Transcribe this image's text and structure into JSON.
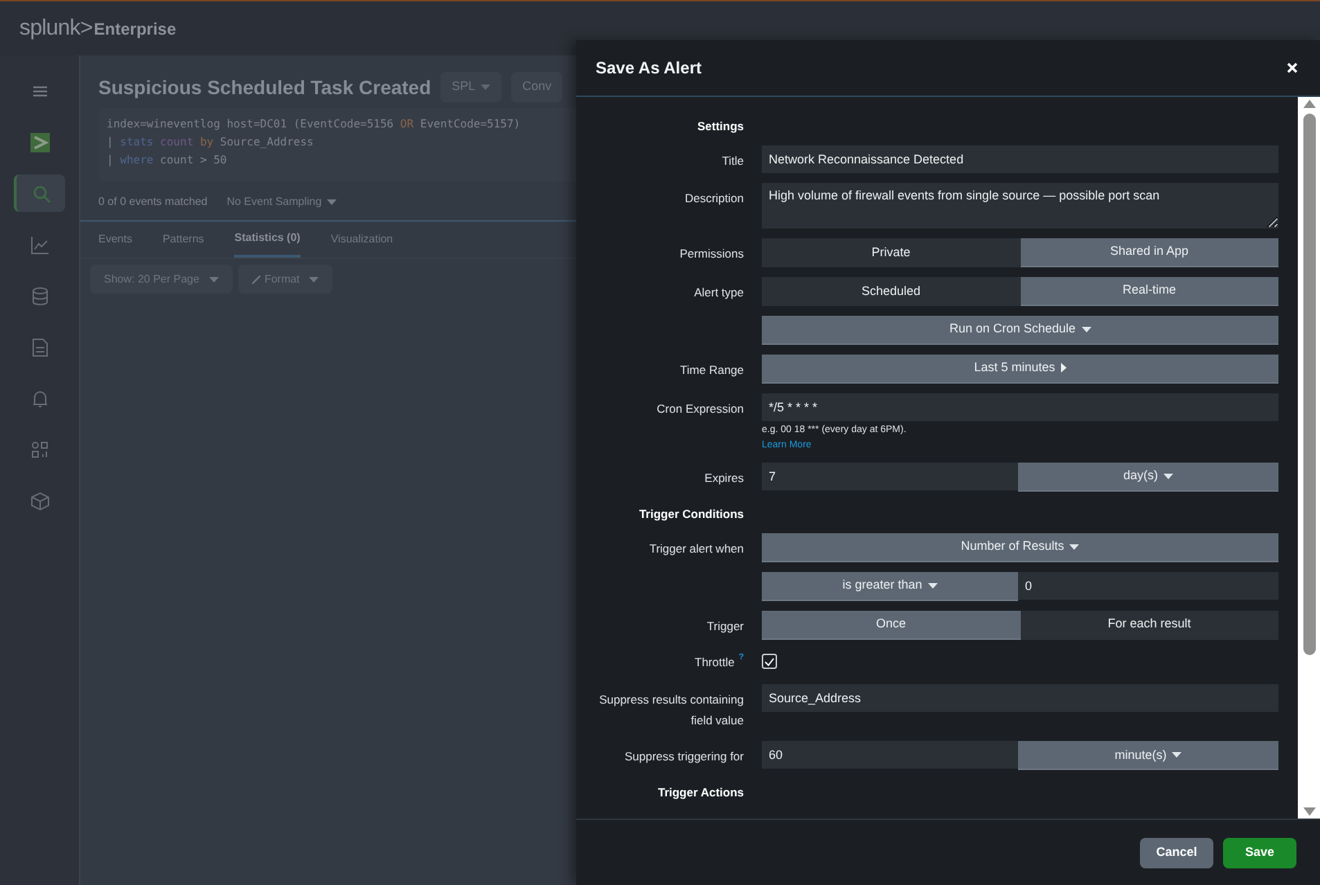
{
  "app_bar": {
    "logo": "splunk>",
    "product": "Enterprise"
  },
  "sidebar": {
    "items": [
      {
        "selected": false
      },
      {
        "selected": false
      },
      {
        "selected": true
      },
      {
        "selected": false
      },
      {
        "selected": false
      },
      {
        "selected": false
      },
      {
        "selected": false
      },
      {
        "selected": false
      },
      {
        "selected": false
      }
    ]
  },
  "search_page": {
    "title": "Suspicious Scheduled Task Created",
    "header_buttons": [
      "SPL",
      "Conv"
    ],
    "query_lines": [
      [
        {
          "text": "index=wineventlog host=DC01 (EventCode=5156 ",
          "kind": "plain"
        },
        {
          "text": "OR",
          "kind": "operator"
        },
        {
          "text": " EventCode=5157)",
          "kind": "plain"
        }
      ],
      [
        {
          "text": "| ",
          "kind": "plain"
        },
        {
          "text": "stats ",
          "kind": "command"
        },
        {
          "text": "count ",
          "kind": "function"
        },
        {
          "text": "by",
          "kind": "operator"
        },
        {
          "text": " Source_Address",
          "kind": "plain"
        }
      ],
      [
        {
          "text": "| ",
          "kind": "plain"
        },
        {
          "text": "where",
          "kind": "command"
        },
        {
          "text": " count > 50",
          "kind": "plain"
        }
      ]
    ],
    "match_count": "0 of 0 events matched",
    "sampling": "No Event Sampling",
    "tabs": [
      {
        "label": "Events",
        "selected": false
      },
      {
        "label": "Patterns",
        "selected": false
      },
      {
        "label": "Statistics (0)",
        "selected": true
      },
      {
        "label": "Visualization",
        "selected": false
      }
    ],
    "toolbar": [
      "Show: 20 Per Page",
      "Format"
    ]
  },
  "dialog": {
    "title": "Save As Alert",
    "rows": [
      {
        "kind": "section",
        "label": "Settings"
      },
      {
        "kind": "text",
        "label": "Title",
        "value": "Network Reconnaissance Detected"
      },
      {
        "kind": "textarea",
        "label": "Description",
        "value": "High volume of firewall events from single source — possible port scan"
      },
      {
        "kind": "segmented",
        "label": "Permissions",
        "options": [
          {
            "label": "Private",
            "selected": false
          },
          {
            "label": "Shared in App",
            "selected": true
          }
        ]
      },
      {
        "kind": "segmented",
        "label": "Alert type",
        "options": [
          {
            "label": "Scheduled",
            "selected": false
          },
          {
            "label": "Real-time",
            "selected": true
          }
        ]
      },
      {
        "kind": "dropdown",
        "value": "Run on Cron Schedule"
      },
      {
        "kind": "menu",
        "label": "Time Range",
        "value": "Last 5 minutes"
      },
      {
        "kind": "cron",
        "label": "Cron Expression",
        "value": "*/5 * * * *",
        "help": "e.g. 00 18 *** (every day at 6PM).",
        "link": "Learn More"
      },
      {
        "kind": "input_dropdown",
        "label": "Expires",
        "value": "7",
        "unit": "day(s)"
      },
      {
        "kind": "section",
        "label": "Trigger Conditions"
      },
      {
        "kind": "dropdown",
        "label": "Trigger alert when",
        "value": "Number of Results"
      },
      {
        "kind": "dropdown_input",
        "option": "is greater than",
        "value": "0"
      },
      {
        "kind": "segmented",
        "label": "Trigger",
        "options": [
          {
            "label": "Once",
            "selected": true
          },
          {
            "label": "For each result",
            "selected": false
          }
        ]
      },
      {
        "kind": "checkbox",
        "label": "Throttle",
        "help": "?",
        "checked": true
      },
      {
        "kind": "text",
        "label": "Suppress results containing field value",
        "value": "Source_Address"
      },
      {
        "kind": "input_dropdown",
        "label": "Suppress triggering for",
        "value": "60",
        "unit": "minute(s)"
      },
      {
        "kind": "section",
        "label": "Trigger Actions"
      }
    ],
    "buttons": [
      {
        "label": "Cancel",
        "kind": "secondary"
      },
      {
        "label": "Save",
        "kind": "primary"
      }
    ]
  }
}
